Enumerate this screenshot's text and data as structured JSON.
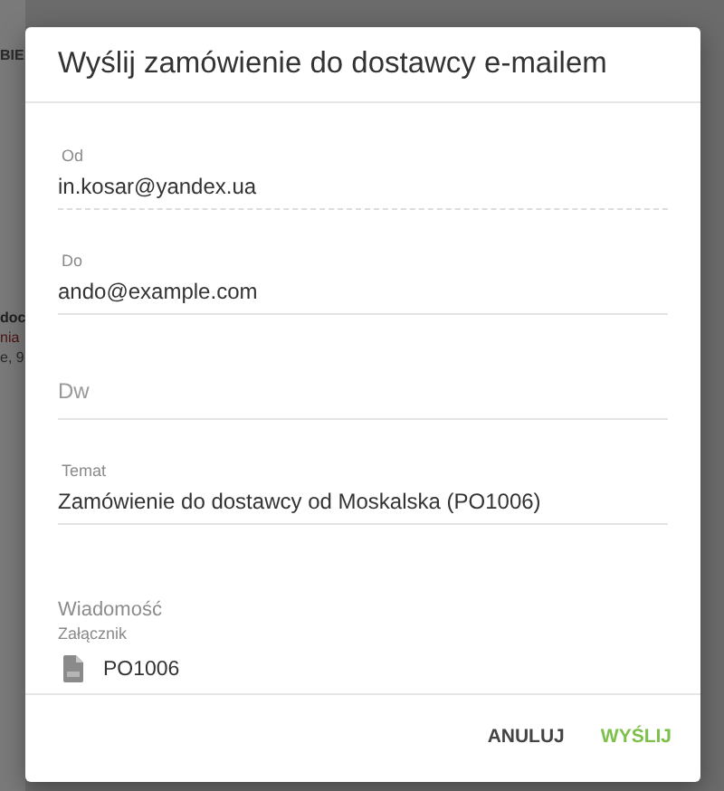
{
  "background": {
    "texts": [
      "BIE",
      "doc",
      "nia",
      "e, 9"
    ]
  },
  "dialog": {
    "title": "Wyślij zamówienie do dostawcy e-mailem",
    "fields": [
      {
        "kind": "filled",
        "label": "Od",
        "value": "in.kosar@yandex.ua"
      },
      {
        "kind": "filled",
        "label": "Do",
        "value": "ando@example.com"
      },
      {
        "kind": "empty",
        "placeholder": "Dw"
      },
      {
        "kind": "filled",
        "label": "Temat",
        "value": "Zamówienie do dostawcy od Moskalska (PO1006)"
      }
    ],
    "message_label": "Wiadomość",
    "attachment": {
      "label": "Załącznik",
      "name": "PO1006"
    },
    "buttons": [
      {
        "label": "ANULUJ",
        "kind": "secondary"
      },
      {
        "label": "WYŚLIJ",
        "kind": "primary"
      }
    ]
  }
}
